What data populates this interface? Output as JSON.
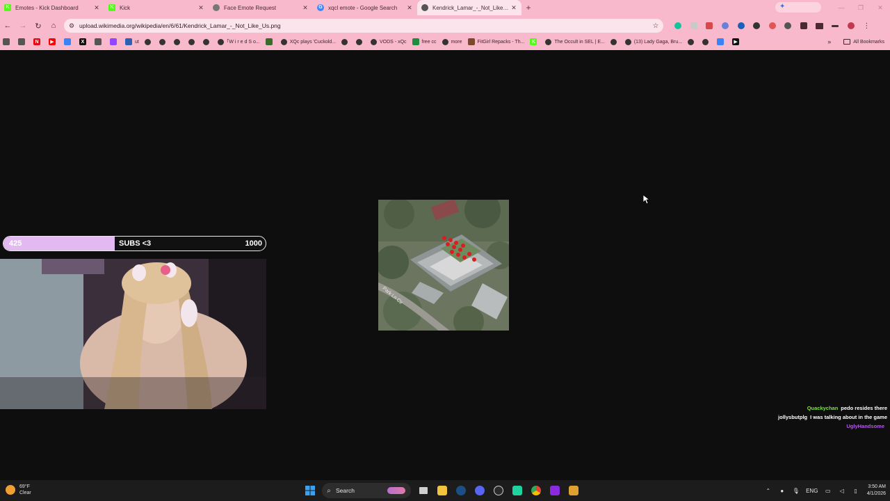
{
  "tabs": [
    {
      "title": "Emotes - Kick Dashboard",
      "icon": "kick-icon",
      "color": "#53fc18",
      "glyph": "K",
      "active": false
    },
    {
      "title": "Kick",
      "icon": "kick-icon",
      "color": "#53fc18",
      "glyph": "K",
      "active": false
    },
    {
      "title": "Face Emote Request",
      "icon": "globe-icon",
      "color": "#777777",
      "glyph": "",
      "active": false
    },
    {
      "title": "xqcl emote - Google Search",
      "icon": "google-icon",
      "color": "#4285f4",
      "glyph": "G",
      "active": false
    },
    {
      "title": "Kendrick_Lamar_-_Not_Like_Us...",
      "icon": "wikimedia-icon",
      "color": "#555555",
      "glyph": "",
      "active": true
    }
  ],
  "toolbar": {
    "url": "upload.wikimedia.org/wikipedia/en/6/61/Kendrick_Lamar_-_Not_Like_Us.png"
  },
  "bookmarks": [
    {
      "label": "",
      "icon": "google-apps-icon",
      "color": "#555555"
    },
    {
      "label": "",
      "icon": "bookmark-icon",
      "color": "#555555"
    },
    {
      "label": "",
      "icon": "netflix-icon",
      "color": "#e50914",
      "glyph": "N"
    },
    {
      "label": "",
      "icon": "youtube-icon",
      "color": "#ff0000",
      "glyph": "▶"
    },
    {
      "label": "",
      "icon": "bookmark-icon",
      "color": "#3b82f6"
    },
    {
      "label": "",
      "icon": "x-icon",
      "color": "#111111",
      "glyph": "X"
    },
    {
      "label": "",
      "icon": "bookmark-icon",
      "color": "#555555"
    },
    {
      "label": "",
      "icon": "twitch-icon",
      "color": "#9146ff"
    },
    {
      "label": "ut",
      "icon": "bookmark-icon",
      "color": "#2f5fb0"
    },
    {
      "label": "",
      "icon": "globe-icon",
      "color": "#333333"
    },
    {
      "label": "",
      "icon": "globe-icon",
      "color": "#333333"
    },
    {
      "label": "",
      "icon": "globe-icon",
      "color": "#333333"
    },
    {
      "label": "",
      "icon": "globe-icon",
      "color": "#333333"
    },
    {
      "label": "",
      "icon": "globe-icon",
      "color": "#333333"
    },
    {
      "label": "｢W i r e d  S o...",
      "icon": "globe-icon",
      "color": "#333333"
    },
    {
      "label": "",
      "icon": "bookmark-icon",
      "color": "#3a6b2a"
    },
    {
      "label": "XQc plays 'Cuckold...",
      "icon": "globe-icon",
      "color": "#333333"
    },
    {
      "label": "",
      "icon": "globe-icon",
      "color": "#333333"
    },
    {
      "label": "",
      "icon": "globe-icon",
      "color": "#333333"
    },
    {
      "label": "VODS - xQc",
      "icon": "globe-icon",
      "color": "#333333"
    },
    {
      "label": "free cc",
      "icon": "sheets-icon",
      "color": "#1e8e3e"
    },
    {
      "label": "more",
      "icon": "globe-icon",
      "color": "#333333"
    },
    {
      "label": "FitGirl Repacks - Th...",
      "icon": "bookmark-icon",
      "color": "#7a4a2a"
    },
    {
      "label": "",
      "icon": "kick-icon",
      "color": "#53fc18",
      "glyph": "K"
    },
    {
      "label": "The Occult in SEL | E...",
      "icon": "globe-icon",
      "color": "#333333"
    },
    {
      "label": "",
      "icon": "globe-icon",
      "color": "#333333"
    },
    {
      "label": "(13) Lady Gaga, Bru...",
      "icon": "globe-icon",
      "color": "#333333"
    },
    {
      "label": "",
      "icon": "globe-icon",
      "color": "#333333"
    },
    {
      "label": "",
      "icon": "globe-icon",
      "color": "#333333"
    },
    {
      "label": "",
      "icon": "bookmark-icon",
      "color": "#3b82f6"
    },
    {
      "label": "",
      "icon": "play-icon",
      "color": "#111111",
      "glyph": "▶"
    }
  ],
  "all_bookmarks": "All Bookmarks",
  "sub_goal": {
    "current": "425",
    "label": "SUBS <3",
    "goal": "1000",
    "progress": 0.425,
    "fill_color": "#e3b9f2"
  },
  "chat": [
    {
      "user": "Quackychan",
      "user_color": "#7fe04a",
      "message": "pedo resides there"
    },
    {
      "user": "jollysbutplg",
      "user_color": "#ffffff",
      "message": "I was talking about in the game"
    },
    {
      "user": "UglyHandsome",
      "user_color": "#b55be8",
      "message": ""
    }
  ],
  "taskbar": {
    "temp": "69°F",
    "condition": "Clear",
    "search": "Search",
    "language": "ENG",
    "time": "3:50 AM",
    "date": "4/1/2026"
  }
}
